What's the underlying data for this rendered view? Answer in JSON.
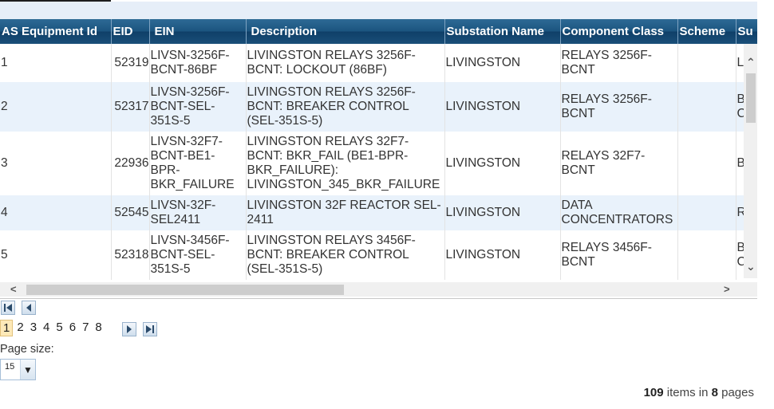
{
  "table": {
    "headers": [
      "AS Equipment Id",
      "EID",
      "EIN",
      "Description",
      "Substation Name",
      "Component Class",
      "Scheme",
      "Su"
    ],
    "rows": [
      {
        "id": "1",
        "eid": "52319",
        "ein": "LIVSN-3256F-\nBCNT-86BF",
        "description": "LIVINGSTON RELAYS 3256F-\nBCNT: LOCKOUT (86BF)",
        "substation": "LIVINGSTON",
        "component_class": "RELAYS 3256F-\nBCNT",
        "scheme": "",
        "su": "L"
      },
      {
        "id": "2",
        "eid": "52317",
        "ein": "LIVSN-3256F-\nBCNT-SEL-\n351S-5",
        "description": "LIVINGSTON RELAYS 3256F-\nBCNT: BREAKER CONTROL\n(SEL-351S-5)",
        "substation": "LIVINGSTON",
        "component_class": "RELAYS 3256F-\nBCNT",
        "scheme": "",
        "su": "B\nC"
      },
      {
        "id": "3",
        "eid": "22936",
        "ein": "LIVSN-32F7-\nBCNT-BE1-\nBPR-\nBKR_FAILURE",
        "description": "LIVINGSTON RELAYS 32F7-\nBCNT: BKR_FAIL (BE1-BPR-\nBKR_FAILURE):\nLIVINGSTON_345_BKR_FAILURE",
        "substation": "LIVINGSTON",
        "component_class": "RELAYS 32F7-\nBCNT",
        "scheme": "",
        "su": "B"
      },
      {
        "id": "4",
        "eid": "52545",
        "ein": "LIVSN-32F-\nSEL2411",
        "description": "LIVINGSTON 32F REACTOR SEL-\n2411",
        "substation": "LIVINGSTON",
        "component_class": "DATA\nCONCENTRATORS",
        "scheme": "",
        "su": "R"
      },
      {
        "id": "5",
        "eid": "52318",
        "ein": "LIVSN-3456F-\nBCNT-SEL-\n351S-5",
        "description": "LIVINGSTON RELAYS 3456F-\nBCNT: BREAKER CONTROL\n(SEL-351S-5)",
        "substation": "LIVINGSTON",
        "component_class": "RELAYS 3456F-\nBCNT",
        "scheme": "",
        "su": "B\nC"
      }
    ]
  },
  "pager": {
    "pages": [
      "1",
      "2",
      "3",
      "4",
      "5",
      "6",
      "7",
      "8"
    ],
    "current": "1",
    "page_size_label": "Page size:",
    "page_size_value": "15",
    "summary_count": "109",
    "summary_mid": " items in ",
    "summary_pages": "8",
    "summary_end": " pages"
  },
  "colors": {
    "header": "#1c5580",
    "alt_row": "#e9f2fb",
    "current_page": "#fde9b8"
  }
}
